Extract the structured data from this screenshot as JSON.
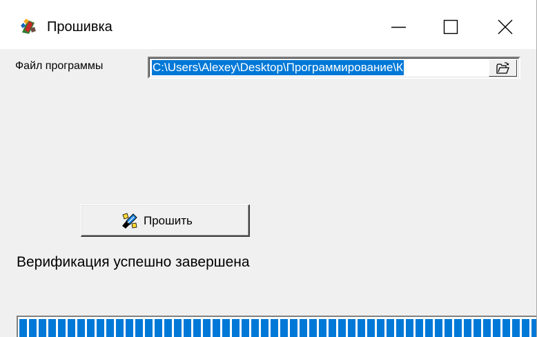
{
  "window": {
    "title": "Прошивка",
    "icon": "app-chip-icon",
    "controls": {
      "minimize_icon": "minimize-icon",
      "maximize_icon": "maximize-icon",
      "close_icon": "close-icon"
    }
  },
  "file": {
    "label": "Файл программы",
    "value": "C:\\Users\\Alexey\\Desktop\\Программирование\\К",
    "browse_icon": "open-folder-icon"
  },
  "flash_button": {
    "label": "Прошить",
    "icon": "flash-wand-icon"
  },
  "status": {
    "text": "Верификация успешно завершена"
  },
  "progress": {
    "fraction": 1.0
  },
  "colors": {
    "accent": "#0078d7",
    "window_bg": "#f0f0f0",
    "titlebar_bg": "#ffffff"
  }
}
